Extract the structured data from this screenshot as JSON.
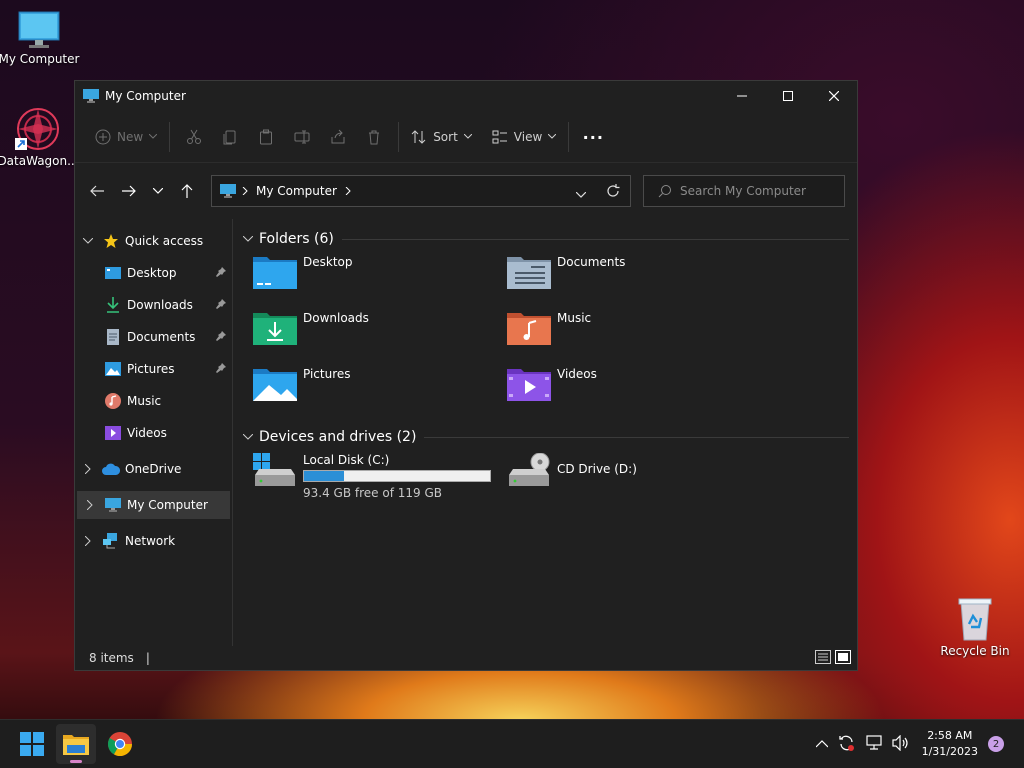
{
  "desktop": {
    "icons": [
      {
        "label": "My Computer"
      },
      {
        "label": "DataWagon..."
      },
      {
        "label": "Recycle Bin"
      }
    ]
  },
  "window": {
    "title": "My Computer",
    "toolbar": {
      "new_label": "New",
      "sort_label": "Sort",
      "view_label": "View",
      "more_label": "..."
    },
    "address": {
      "crumb": "My Computer"
    },
    "search": {
      "placeholder": "Search My Computer"
    },
    "sidebar": {
      "quick_access": "Quick access",
      "items": [
        {
          "label": "Desktop"
        },
        {
          "label": "Downloads"
        },
        {
          "label": "Documents"
        },
        {
          "label": "Pictures"
        },
        {
          "label": "Music"
        },
        {
          "label": "Videos"
        }
      ],
      "onedrive": "OneDrive",
      "mycomputer": "My Computer",
      "network": "Network"
    },
    "folders_group": "Folders (6)",
    "folders": [
      {
        "name": "Desktop"
      },
      {
        "name": "Documents"
      },
      {
        "name": "Downloads"
      },
      {
        "name": "Music"
      },
      {
        "name": "Pictures"
      },
      {
        "name": "Videos"
      }
    ],
    "drives_group": "Devices and drives (2)",
    "drives": [
      {
        "name": "Local Disk (C:)",
        "free_text": "93.4 GB free of 119 GB",
        "used_fraction": 0.215
      },
      {
        "name": "CD Drive (D:)"
      }
    ],
    "status": {
      "items": "8 items",
      "sep": "|"
    }
  },
  "taskbar": {
    "time": "2:58 AM",
    "date": "1/31/2023",
    "notifications": "2"
  }
}
